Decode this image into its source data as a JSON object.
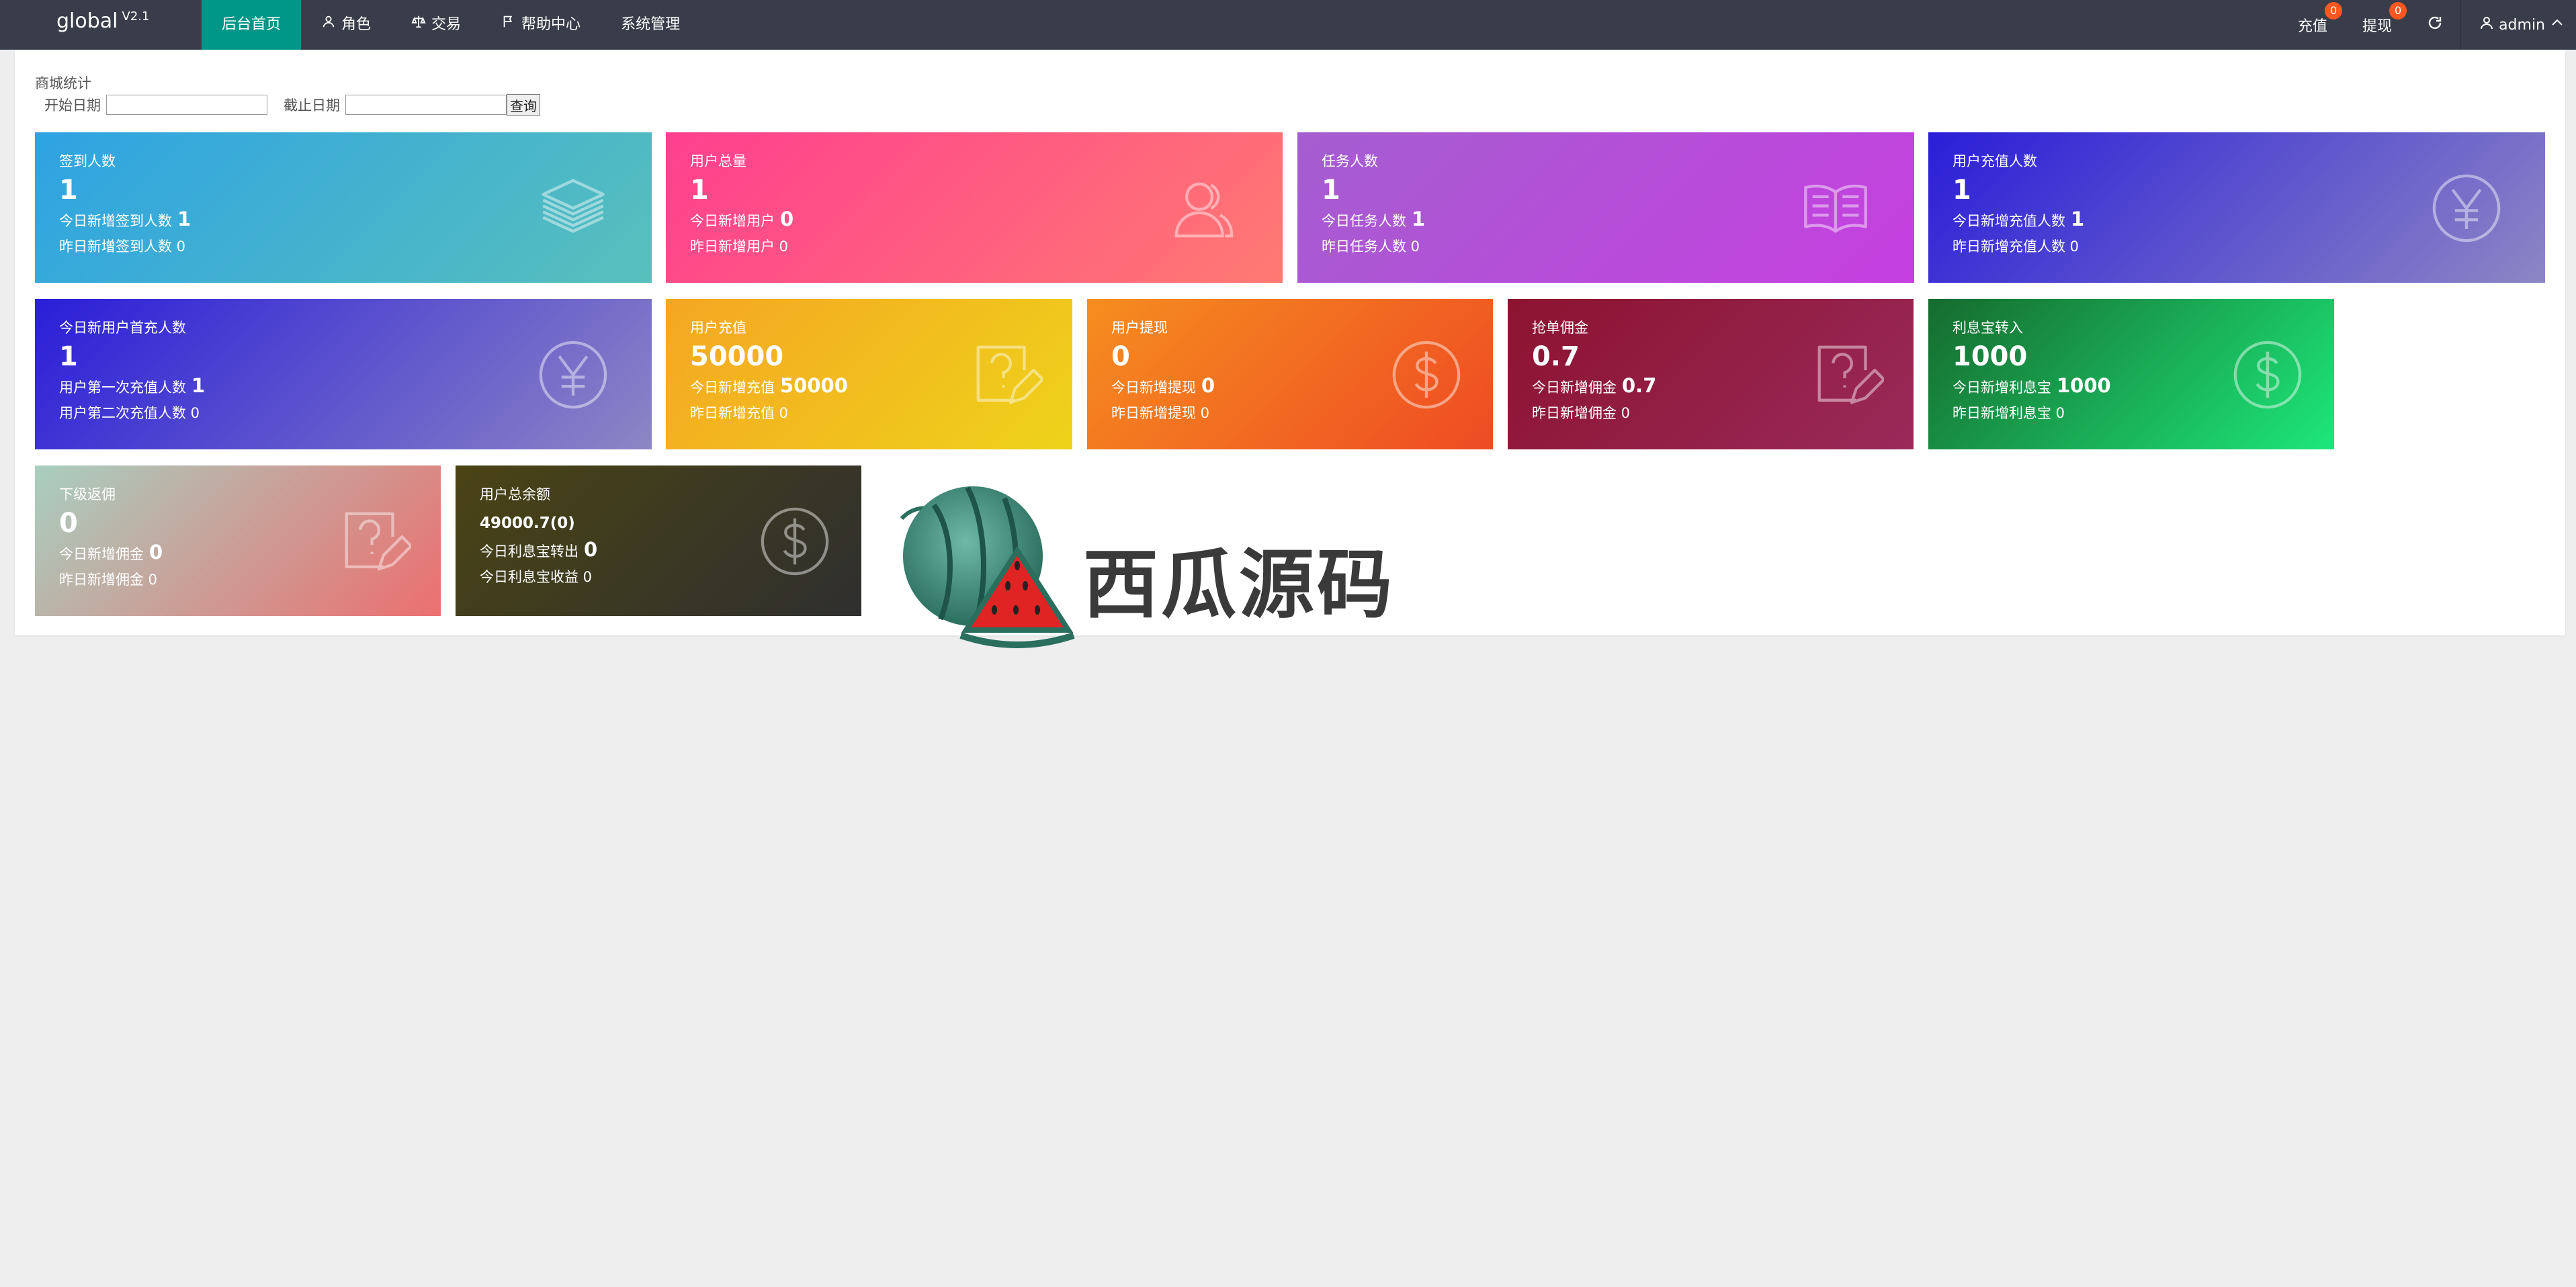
{
  "app": {
    "name": "global",
    "version": "V2.1"
  },
  "nav": [
    {
      "label": "后台首页",
      "icon": "",
      "active": true
    },
    {
      "label": "角色",
      "icon": "user-icon",
      "active": false
    },
    {
      "label": "交易",
      "icon": "scale-icon",
      "active": false
    },
    {
      "label": "帮助中心",
      "icon": "flag-icon",
      "active": false
    },
    {
      "label": "系统管理",
      "icon": "",
      "active": false
    }
  ],
  "right_nav": {
    "recharge": {
      "label": "充值",
      "badge": "0"
    },
    "withdraw": {
      "label": "提现",
      "badge": "0"
    },
    "refresh_icon": "refresh-icon",
    "user": {
      "label": "admin",
      "icon": "user-icon"
    }
  },
  "section": {
    "title": "商城统计"
  },
  "filter": {
    "start_label": "开始日期",
    "end_label": "截止日期",
    "start_value": "",
    "end_value": "",
    "query_label": "查询"
  },
  "cards": [
    {
      "label": "签到人数",
      "value": "1",
      "sub1_label": "今日新增签到人数",
      "sub1_value": "1",
      "sub2": "昨日新增签到人数 0",
      "icon": "layers-icon",
      "gradient": [
        "#2ea3e3",
        "#58c0bc"
      ]
    },
    {
      "label": "用户总量",
      "value": "1",
      "sub1_label": "今日新增用户",
      "sub1_value": "0",
      "sub2": "昨日新增用户 0",
      "icon": "users-icon",
      "gradient": [
        "#ff3f8f",
        "#ff7a72"
      ]
    },
    {
      "label": "任务人数",
      "value": "1",
      "sub1_label": "今日任务人数",
      "sub1_value": "1",
      "sub2": "昨日任务人数 0",
      "icon": "book-icon",
      "gradient": [
        "#a45ed0",
        "#c63fe0"
      ]
    },
    {
      "label": "用户充值人数",
      "value": "1",
      "sub1_label": "今日新增充值人数",
      "sub1_value": "1",
      "sub2": "昨日新增充值人数 0",
      "icon": "yen-icon",
      "gradient": [
        "#2a1ed8",
        "#8d86c4"
      ]
    },
    {
      "label": "今日新用户首充人数",
      "value": "1",
      "sub1_label": "用户第一次充值人数",
      "sub1_value": "1",
      "sub2": "用户第二次充值人数 0",
      "icon": "yen-icon",
      "gradient": [
        "#2a1ed8",
        "#8d86c4"
      ]
    },
    {
      "label": "用户充值",
      "value": "50000",
      "sub1_label": "今日新增充值",
      "sub1_value": "50000",
      "sub2": "昨日新增充值 0",
      "icon": "question-edit-icon",
      "gradient": [
        "#f5a623",
        "#eed31a"
      ]
    },
    {
      "label": "用户提现",
      "value": "0",
      "sub1_label": "今日新增提现",
      "sub1_value": "0",
      "sub2": "昨日新增提现 0",
      "icon": "dollar-icon",
      "gradient": [
        "#f68d1f",
        "#ee4b23"
      ]
    },
    {
      "label": "抢单佣金",
      "value": "0.7",
      "sub1_label": "今日新增佣金",
      "sub1_value": "0.7",
      "sub2": "昨日新增佣金 0",
      "icon": "question-edit-icon",
      "gradient": [
        "#8c1330",
        "#9a2a5a"
      ]
    },
    {
      "label": "利息宝转入",
      "value": "1000",
      "sub1_label": "今日新增利息宝",
      "sub1_value": "1000",
      "sub2": "昨日新增利息宝 0",
      "icon": "dollar-icon",
      "gradient": [
        "#166b2e",
        "#1de77a"
      ]
    },
    {
      "label": "下级返佣",
      "value": "0",
      "sub1_label": "今日新增佣金",
      "sub1_value": "0",
      "sub2": "昨日新增佣金 0",
      "icon": "question-edit-icon",
      "gradient": [
        "#a8cfc0",
        "#ec6f6f"
      ]
    },
    {
      "label": "用户总余额",
      "value": "49000.7(0)",
      "sub1_label": "今日利息宝转出",
      "sub1_value": "0",
      "sub2": "今日利息宝收益 0",
      "icon": "dollar-icon",
      "gradient": [
        "#4a4414",
        "#2f2f2f"
      ]
    }
  ],
  "watermark": {
    "text": "西瓜源码",
    "icon": "watermelon-icon"
  }
}
